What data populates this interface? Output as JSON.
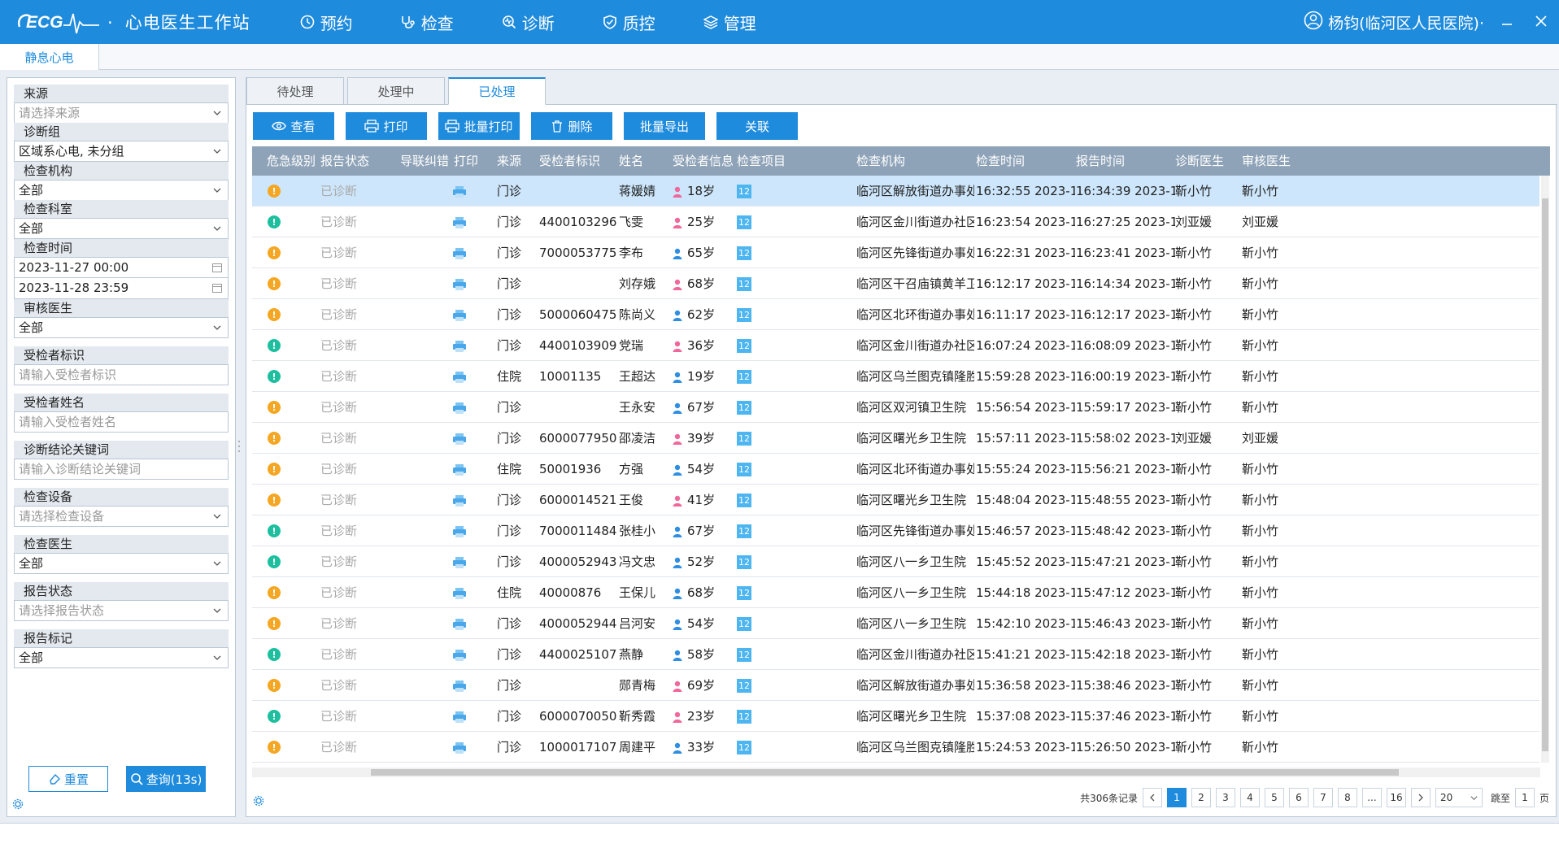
{
  "app": {
    "logo_text": "ECG",
    "title": "心电医生工作站",
    "nav": [
      {
        "label": "预约",
        "icon": "clock-icon"
      },
      {
        "label": "检查",
        "icon": "stethoscope-icon"
      },
      {
        "label": "诊断",
        "icon": "diagnosis-icon"
      },
      {
        "label": "质控",
        "icon": "shield-check-icon"
      },
      {
        "label": "管理",
        "icon": "layers-icon"
      }
    ],
    "user": "杨钧(临河区人民医院)·"
  },
  "module_tab": "静息心电",
  "filters": {
    "source": {
      "label": "来源",
      "placeholder": "请选择来源"
    },
    "group": {
      "label": "诊断组",
      "value": "区域系心电, 未分组"
    },
    "institution": {
      "label": "检查机构",
      "value": "全部"
    },
    "department": {
      "label": "检查科室",
      "value": "全部"
    },
    "time": {
      "label": "检查时间",
      "start": "2023-11-27 00:00",
      "end": "2023-11-28 23:59"
    },
    "reviewer": {
      "label": "审核医生",
      "value": "全部"
    },
    "patient_id": {
      "label": "受检者标识",
      "placeholder": "请输入受检者标识"
    },
    "patient_name": {
      "label": "受检者姓名",
      "placeholder": "请输入受检者姓名"
    },
    "keyword": {
      "label": "诊断结论关键词",
      "placeholder": "请输入诊断结论关键词"
    },
    "device": {
      "label": "检查设备",
      "placeholder": "请选择检查设备"
    },
    "exam_doctor": {
      "label": "检查医生",
      "value": "全部"
    },
    "report_status": {
      "label": "报告状态",
      "placeholder": "请选择报告状态"
    },
    "report_mark": {
      "label": "报告标记",
      "value": "全部"
    },
    "reset": "重置",
    "query": "查询(13s)"
  },
  "status_tabs": [
    "待处理",
    "处理中",
    "已处理"
  ],
  "toolbar": {
    "view": "查看",
    "print": "打印",
    "batch_print": "批量打印",
    "delete": "删除",
    "batch_export": "批量导出",
    "link": "关联"
  },
  "columns": [
    "危急级别",
    "报告状态",
    "导联纠错",
    "打印",
    "来源",
    "受检者标识",
    "姓名",
    "受检者信息",
    "检查项目",
    "检查机构",
    "检查时间",
    "报告时间",
    "诊断医生",
    "审核医生"
  ],
  "rows": [
    {
      "level": "orange",
      "status": "已诊断",
      "source": "门诊",
      "pid": "",
      "name": "蒋媛婧",
      "gender": "female",
      "age": "18岁",
      "item": "12",
      "org": "临河区解放街道办事处...",
      "exam_time": "16:32:55 2023-11...",
      "report_time": "16:34:39 2023-11...",
      "diag": "靳小竹",
      "review": "靳小竹",
      "selected": true
    },
    {
      "level": "green",
      "status": "已诊断",
      "source": "门诊",
      "pid": "4400103296",
      "name": "飞雯",
      "gender": "female",
      "age": "25岁",
      "item": "12",
      "org": "临河区金川街道办社区...",
      "exam_time": "16:23:54 2023-11...",
      "report_time": "16:27:25 2023-11...",
      "diag": "刘亚媛",
      "review": "刘亚媛"
    },
    {
      "level": "orange",
      "status": "已诊断",
      "source": "门诊",
      "pid": "7000053775",
      "name": "李布",
      "gender": "male",
      "age": "65岁",
      "item": "12",
      "org": "临河区先锋街道办事处...",
      "exam_time": "16:22:31 2023-11...",
      "report_time": "16:23:41 2023-11...",
      "diag": "靳小竹",
      "review": "靳小竹"
    },
    {
      "level": "orange",
      "status": "已诊断",
      "source": "门诊",
      "pid": "",
      "name": "刘存娥",
      "gender": "female",
      "age": "68岁",
      "item": "12",
      "org": "临河区干召庙镇黄羊卫...",
      "exam_time": "16:12:17 2023-11...",
      "report_time": "16:14:34 2023-11...",
      "diag": "靳小竹",
      "review": "靳小竹"
    },
    {
      "level": "orange",
      "status": "已诊断",
      "source": "门诊",
      "pid": "5000060475",
      "name": "陈尚义",
      "gender": "male",
      "age": "62岁",
      "item": "12",
      "org": "临河区北环街道办事处...",
      "exam_time": "16:11:17 2023-11...",
      "report_time": "16:12:17 2023-11...",
      "diag": "靳小竹",
      "review": "靳小竹"
    },
    {
      "level": "green",
      "status": "已诊断",
      "source": "门诊",
      "pid": "4400103909",
      "name": "党瑞",
      "gender": "female",
      "age": "36岁",
      "item": "12",
      "org": "临河区金川街道办社区...",
      "exam_time": "16:07:24 2023-11...",
      "report_time": "16:08:09 2023-11...",
      "diag": "靳小竹",
      "review": "靳小竹"
    },
    {
      "level": "green",
      "status": "已诊断",
      "source": "住院",
      "pid": "10001135",
      "name": "王超达",
      "gender": "male",
      "age": "19岁",
      "item": "12",
      "org": "临河区乌兰图克镇隆胜...",
      "exam_time": "15:59:28 2023-11...",
      "report_time": "16:00:19 2023-11...",
      "diag": "靳小竹",
      "review": "靳小竹"
    },
    {
      "level": "orange",
      "status": "已诊断",
      "source": "门诊",
      "pid": "",
      "name": "王永安",
      "gender": "male",
      "age": "67岁",
      "item": "12",
      "org": "临河区双河镇卫生院",
      "exam_time": "15:56:54 2023-11...",
      "report_time": "15:59:17 2023-11...",
      "diag": "靳小竹",
      "review": "靳小竹"
    },
    {
      "level": "orange",
      "status": "已诊断",
      "source": "门诊",
      "pid": "6000077950",
      "name": "邵凌洁",
      "gender": "female",
      "age": "39岁",
      "item": "12",
      "org": "临河区曙光乡卫生院",
      "exam_time": "15:57:11 2023-11...",
      "report_time": "15:58:02 2023-11...",
      "diag": "刘亚媛",
      "review": "刘亚媛"
    },
    {
      "level": "orange",
      "status": "已诊断",
      "source": "住院",
      "pid": "50001936",
      "name": "方强",
      "gender": "male",
      "age": "54岁",
      "item": "12",
      "org": "临河区北环街道办事处...",
      "exam_time": "15:55:24 2023-11...",
      "report_time": "15:56:21 2023-11...",
      "diag": "靳小竹",
      "review": "靳小竹"
    },
    {
      "level": "orange",
      "status": "已诊断",
      "source": "门诊",
      "pid": "6000014521",
      "name": "王俊",
      "gender": "female",
      "age": "41岁",
      "item": "12",
      "org": "临河区曙光乡卫生院",
      "exam_time": "15:48:04 2023-11...",
      "report_time": "15:48:55 2023-11...",
      "diag": "靳小竹",
      "review": "靳小竹"
    },
    {
      "level": "green",
      "status": "已诊断",
      "source": "门诊",
      "pid": "7000011484",
      "name": "张桂小",
      "gender": "male",
      "age": "67岁",
      "item": "12",
      "org": "临河区先锋街道办事处...",
      "exam_time": "15:46:57 2023-11...",
      "report_time": "15:48:42 2023-11...",
      "diag": "靳小竹",
      "review": "靳小竹"
    },
    {
      "level": "green",
      "status": "已诊断",
      "source": "门诊",
      "pid": "4000052943",
      "name": "冯文忠",
      "gender": "male",
      "age": "52岁",
      "item": "12",
      "org": "临河区八一乡卫生院",
      "exam_time": "15:45:52 2023-11...",
      "report_time": "15:47:21 2023-11...",
      "diag": "靳小竹",
      "review": "靳小竹"
    },
    {
      "level": "orange",
      "status": "已诊断",
      "source": "住院",
      "pid": "40000876",
      "name": "王保儿",
      "gender": "male",
      "age": "68岁",
      "item": "12",
      "org": "临河区八一乡卫生院",
      "exam_time": "15:44:18 2023-11...",
      "report_time": "15:47:12 2023-11...",
      "diag": "靳小竹",
      "review": "靳小竹"
    },
    {
      "level": "orange",
      "status": "已诊断",
      "source": "门诊",
      "pid": "4000052944",
      "name": "吕河安",
      "gender": "male",
      "age": "54岁",
      "item": "12",
      "org": "临河区八一乡卫生院",
      "exam_time": "15:42:10 2023-11...",
      "report_time": "15:46:43 2023-11...",
      "diag": "靳小竹",
      "review": "靳小竹"
    },
    {
      "level": "green",
      "status": "已诊断",
      "source": "门诊",
      "pid": "4400025107",
      "name": "燕静",
      "gender": "male",
      "age": "58岁",
      "item": "12",
      "org": "临河区金川街道办社区...",
      "exam_time": "15:41:21 2023-11...",
      "report_time": "15:42:18 2023-11...",
      "diag": "靳小竹",
      "review": "靳小竹"
    },
    {
      "level": "orange",
      "status": "已诊断",
      "source": "门诊",
      "pid": "",
      "name": "郧青梅",
      "gender": "female",
      "age": "69岁",
      "item": "12",
      "org": "临河区解放街道办事处...",
      "exam_time": "15:36:58 2023-11...",
      "report_time": "15:38:46 2023-11...",
      "diag": "靳小竹",
      "review": "靳小竹"
    },
    {
      "level": "green",
      "status": "已诊断",
      "source": "门诊",
      "pid": "6000070050",
      "name": "靳秀霞",
      "gender": "female",
      "age": "23岁",
      "item": "12",
      "org": "临河区曙光乡卫生院",
      "exam_time": "15:37:08 2023-11...",
      "report_time": "15:37:46 2023-11...",
      "diag": "靳小竹",
      "review": "靳小竹"
    },
    {
      "level": "orange",
      "status": "已诊断",
      "source": "门诊",
      "pid": "1000017107",
      "name": "周建平",
      "gender": "male",
      "age": "33岁",
      "item": "12",
      "org": "临河区乌兰图克镇隆胜...",
      "exam_time": "15:24:53 2023-11...",
      "report_time": "15:26:50 2023-11...",
      "diag": "靳小竹",
      "review": "靳小竹"
    }
  ],
  "pager": {
    "total": "共306条记录",
    "pages": [
      "1",
      "2",
      "3",
      "4",
      "5",
      "6",
      "7",
      "8",
      "...",
      "16"
    ],
    "size": "20",
    "jump_label": "跳至",
    "jump_value": "1",
    "page_unit": "页"
  },
  "colors": {
    "primary": "#1f8bdc",
    "level_orange": "#f5a623",
    "level_green": "#1dbf9f",
    "female": "#f0679b",
    "male": "#2f8ee0"
  }
}
